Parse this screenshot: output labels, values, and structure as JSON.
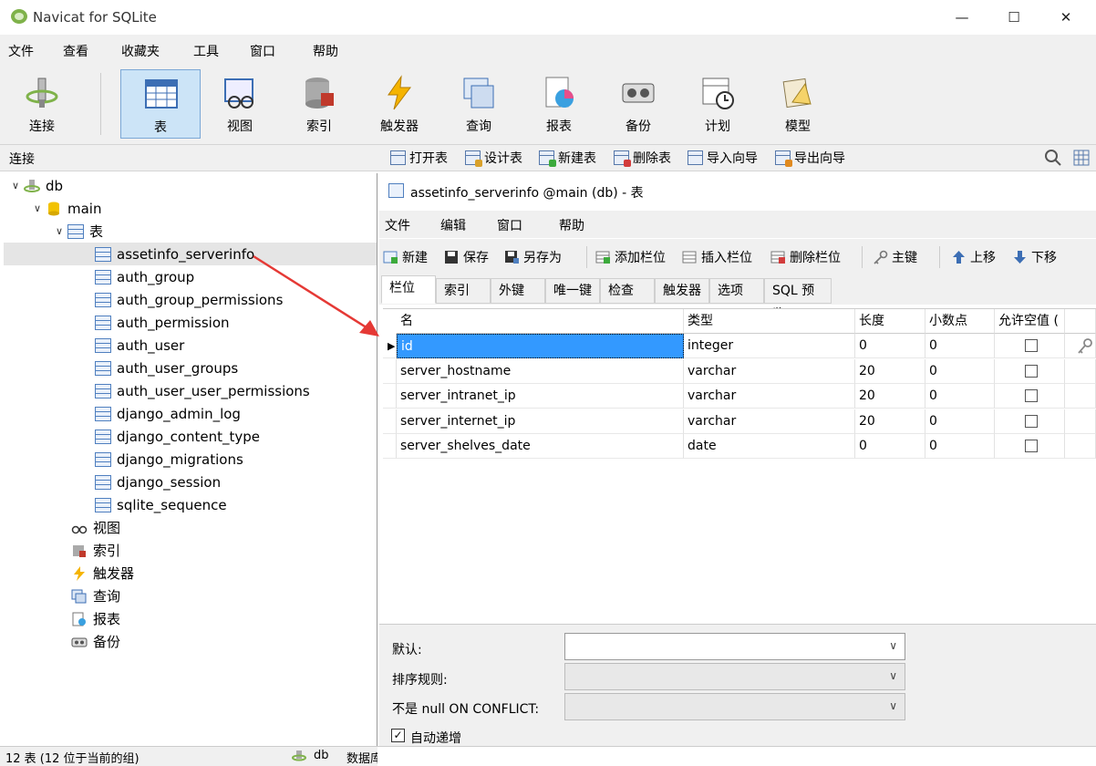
{
  "window": {
    "title": "Navicat for SQLite",
    "minimize": "—",
    "maximize": "☐",
    "close": "✕"
  },
  "menu": [
    "文件",
    "查看",
    "收藏夹",
    "工具",
    "窗口",
    "帮助"
  ],
  "toolbar": [
    {
      "label": "连接",
      "icon": "connection-icon"
    },
    {
      "label": "表",
      "icon": "table-icon",
      "active": true
    },
    {
      "label": "视图",
      "icon": "view-icon"
    },
    {
      "label": "索引",
      "icon": "index-icon"
    },
    {
      "label": "触发器",
      "icon": "trigger-icon"
    },
    {
      "label": "查询",
      "icon": "query-icon"
    },
    {
      "label": "报表",
      "icon": "report-icon"
    },
    {
      "label": "备份",
      "icon": "backup-icon"
    },
    {
      "label": "计划",
      "icon": "schedule-icon"
    },
    {
      "label": "模型",
      "icon": "model-icon"
    }
  ],
  "objectbar": {
    "connection_label": "连接",
    "buttons": [
      "打开表",
      "设计表",
      "新建表",
      "删除表",
      "导入向导",
      "导出向导"
    ]
  },
  "tree": {
    "db": "db",
    "schema": "main",
    "tables_node": "表",
    "tables": [
      "assetinfo_serverinfo",
      "auth_group",
      "auth_group_permissions",
      "auth_permission",
      "auth_user",
      "auth_user_groups",
      "auth_user_user_permissions",
      "django_admin_log",
      "django_content_type",
      "django_migrations",
      "django_session",
      "sqlite_sequence"
    ],
    "selected_table": "assetinfo_serverinfo",
    "other_nodes": [
      "视图",
      "索引",
      "触发器",
      "查询",
      "报表",
      "备份"
    ]
  },
  "status": {
    "left": "12 表 (12 位于当前的组)",
    "db": "db",
    "right": "数据库"
  },
  "designer": {
    "title": "assetinfo_serverinfo @main (db) - 表",
    "menu": [
      "文件",
      "编辑",
      "窗口",
      "帮助"
    ],
    "toolbar": [
      "新建",
      "保存",
      "另存为",
      "添加栏位",
      "插入栏位",
      "删除栏位",
      "主键",
      "上移",
      "下移"
    ],
    "tabs": [
      "栏位",
      "索引",
      "外键",
      "唯一键",
      "检查",
      "触发器",
      "选项",
      "SQL 预览"
    ],
    "columns": [
      "名",
      "类型",
      "长度",
      "小数点",
      "允许空值 ("
    ],
    "rows": [
      {
        "name": "id",
        "type": "integer",
        "length": "0",
        "decimals": "0",
        "nullable": false,
        "key": true
      },
      {
        "name": "server_hostname",
        "type": "varchar",
        "length": "20",
        "decimals": "0",
        "nullable": false
      },
      {
        "name": "server_intranet_ip",
        "type": "varchar",
        "length": "20",
        "decimals": "0",
        "nullable": false
      },
      {
        "name": "server_internet_ip",
        "type": "varchar",
        "length": "20",
        "decimals": "0",
        "nullable": false
      },
      {
        "name": "server_shelves_date",
        "type": "date",
        "length": "0",
        "decimals": "0",
        "nullable": false
      }
    ],
    "props": {
      "default_label": "默认:",
      "collation_label": "排序规则:",
      "notnull_label": "不是 null ON CONFLICT:",
      "autoinc_label": "自动递增",
      "autoinc_checked": true
    }
  },
  "colors": {
    "selection": "#3399ff",
    "active_tool": "#cce4f7",
    "arrow": "#e53935"
  }
}
